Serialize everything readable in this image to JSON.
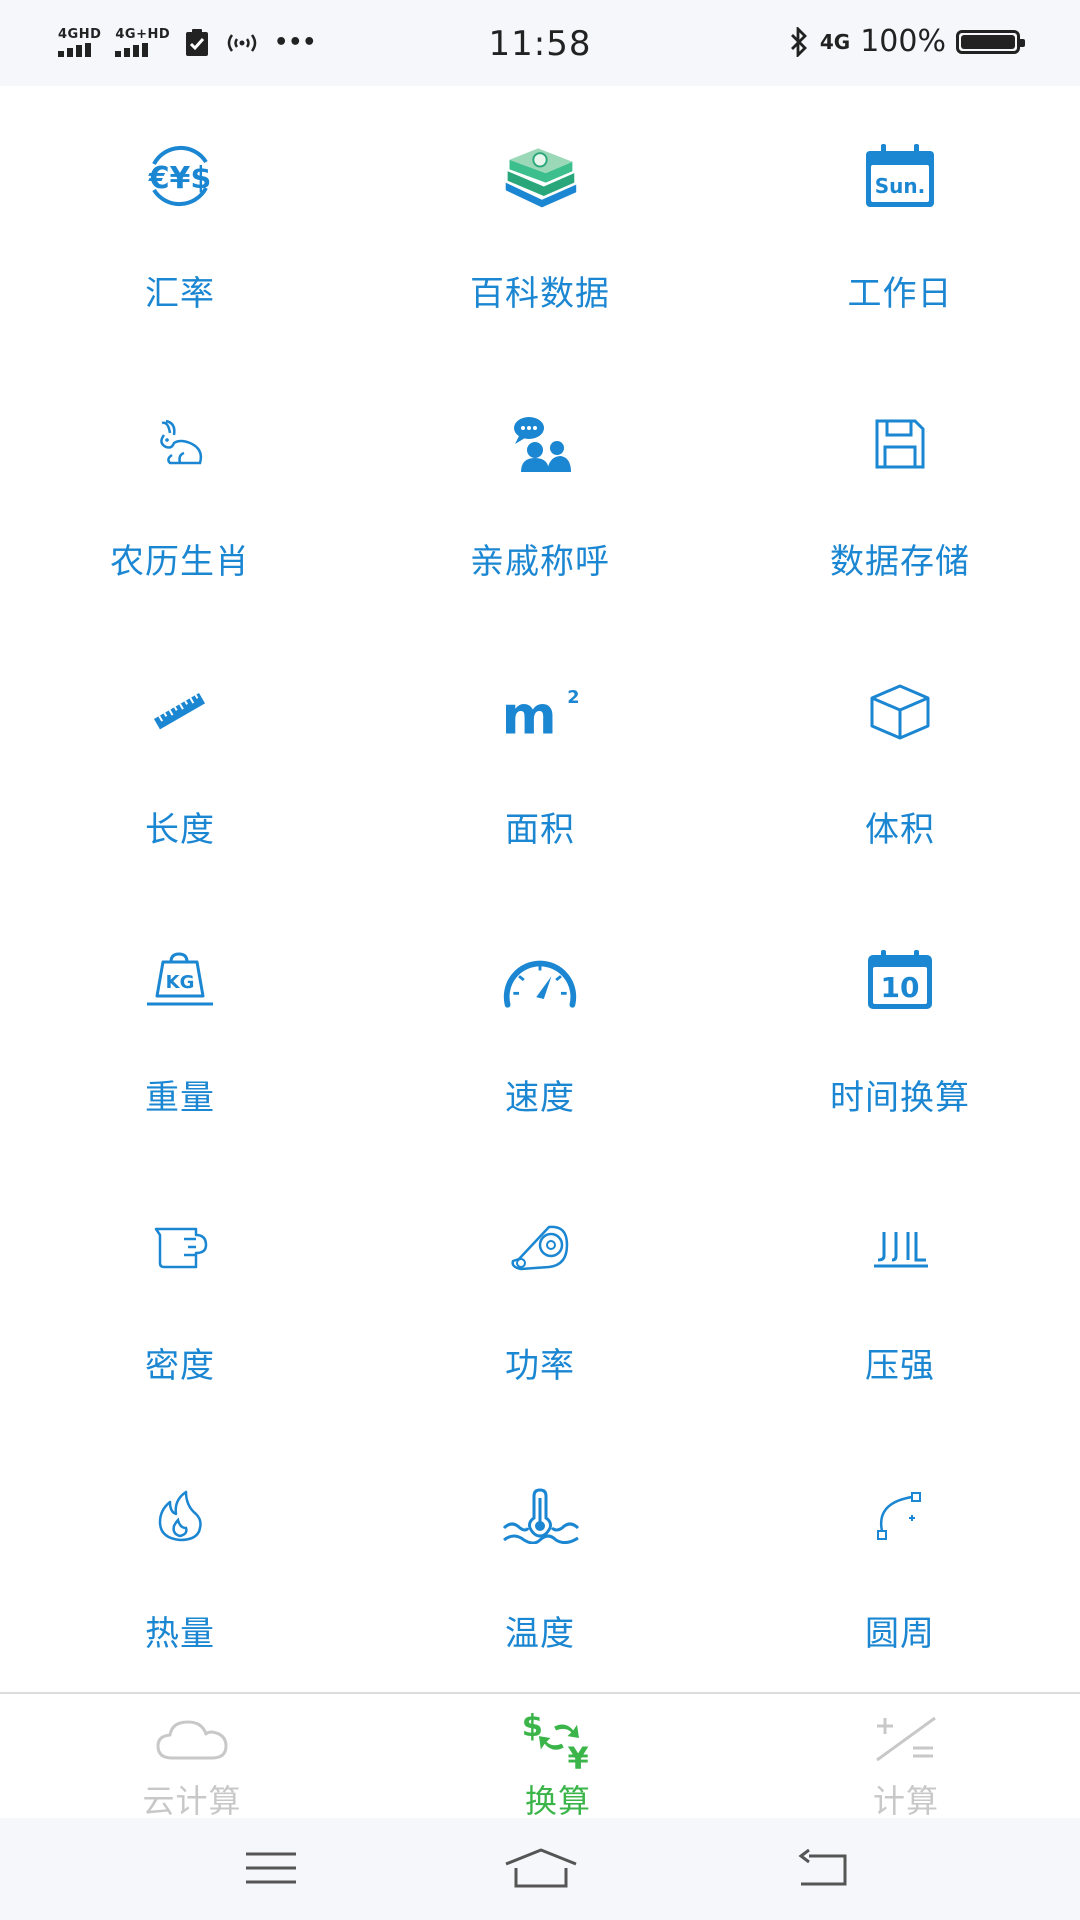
{
  "status_bar": {
    "sim1": "4GHD",
    "sim2": "4G+HD",
    "more": "•••",
    "time": "11:58",
    "network": "4G",
    "battery": "100%",
    "battery_level": 1.0
  },
  "grid": {
    "items": [
      {
        "label": "汇率",
        "icon": "currency-exchange-icon"
      },
      {
        "label": "百科数据",
        "icon": "books-icon"
      },
      {
        "label": "工作日",
        "icon": "calendar-sun-icon"
      },
      {
        "label": "农历生肖",
        "icon": "rabbit-icon"
      },
      {
        "label": "亲戚称呼",
        "icon": "family-chat-icon"
      },
      {
        "label": "数据存储",
        "icon": "floppy-disk-icon"
      },
      {
        "label": "长度",
        "icon": "ruler-icon"
      },
      {
        "label": "面积",
        "icon": "square-meter-icon"
      },
      {
        "label": "体积",
        "icon": "cube-icon"
      },
      {
        "label": "重量",
        "icon": "weight-kg-icon"
      },
      {
        "label": "速度",
        "icon": "speedometer-icon"
      },
      {
        "label": "时间换算",
        "icon": "calendar-10-icon"
      },
      {
        "label": "密度",
        "icon": "measuring-cup-icon"
      },
      {
        "label": "功率",
        "icon": "belt-pulley-icon"
      },
      {
        "label": "压强",
        "icon": "pressure-icon"
      },
      {
        "label": "热量",
        "icon": "flame-icon"
      },
      {
        "label": "温度",
        "icon": "thermometer-icon"
      },
      {
        "label": "圆周",
        "icon": "circle-arc-icon"
      }
    ],
    "unit_square": "m",
    "unit_sup": "2",
    "weight_text": "KG",
    "calendar_sun": "Sun.",
    "calendar_day": "10",
    "currency_text": "€¥$"
  },
  "tabbar": {
    "tabs": [
      {
        "label": "云计算",
        "icon": "cloud-icon",
        "active": false
      },
      {
        "label": "换算",
        "icon": "dollar-yen-exchange-icon",
        "active": true
      },
      {
        "label": "计算",
        "icon": "plus-minus-equals-icon",
        "active": false
      }
    ]
  },
  "colors": {
    "accent": "#1b86d1",
    "active_tab": "#3bb54a",
    "inactive_tab": "#c8c8c8",
    "status_bg": "#f6f7fb"
  }
}
